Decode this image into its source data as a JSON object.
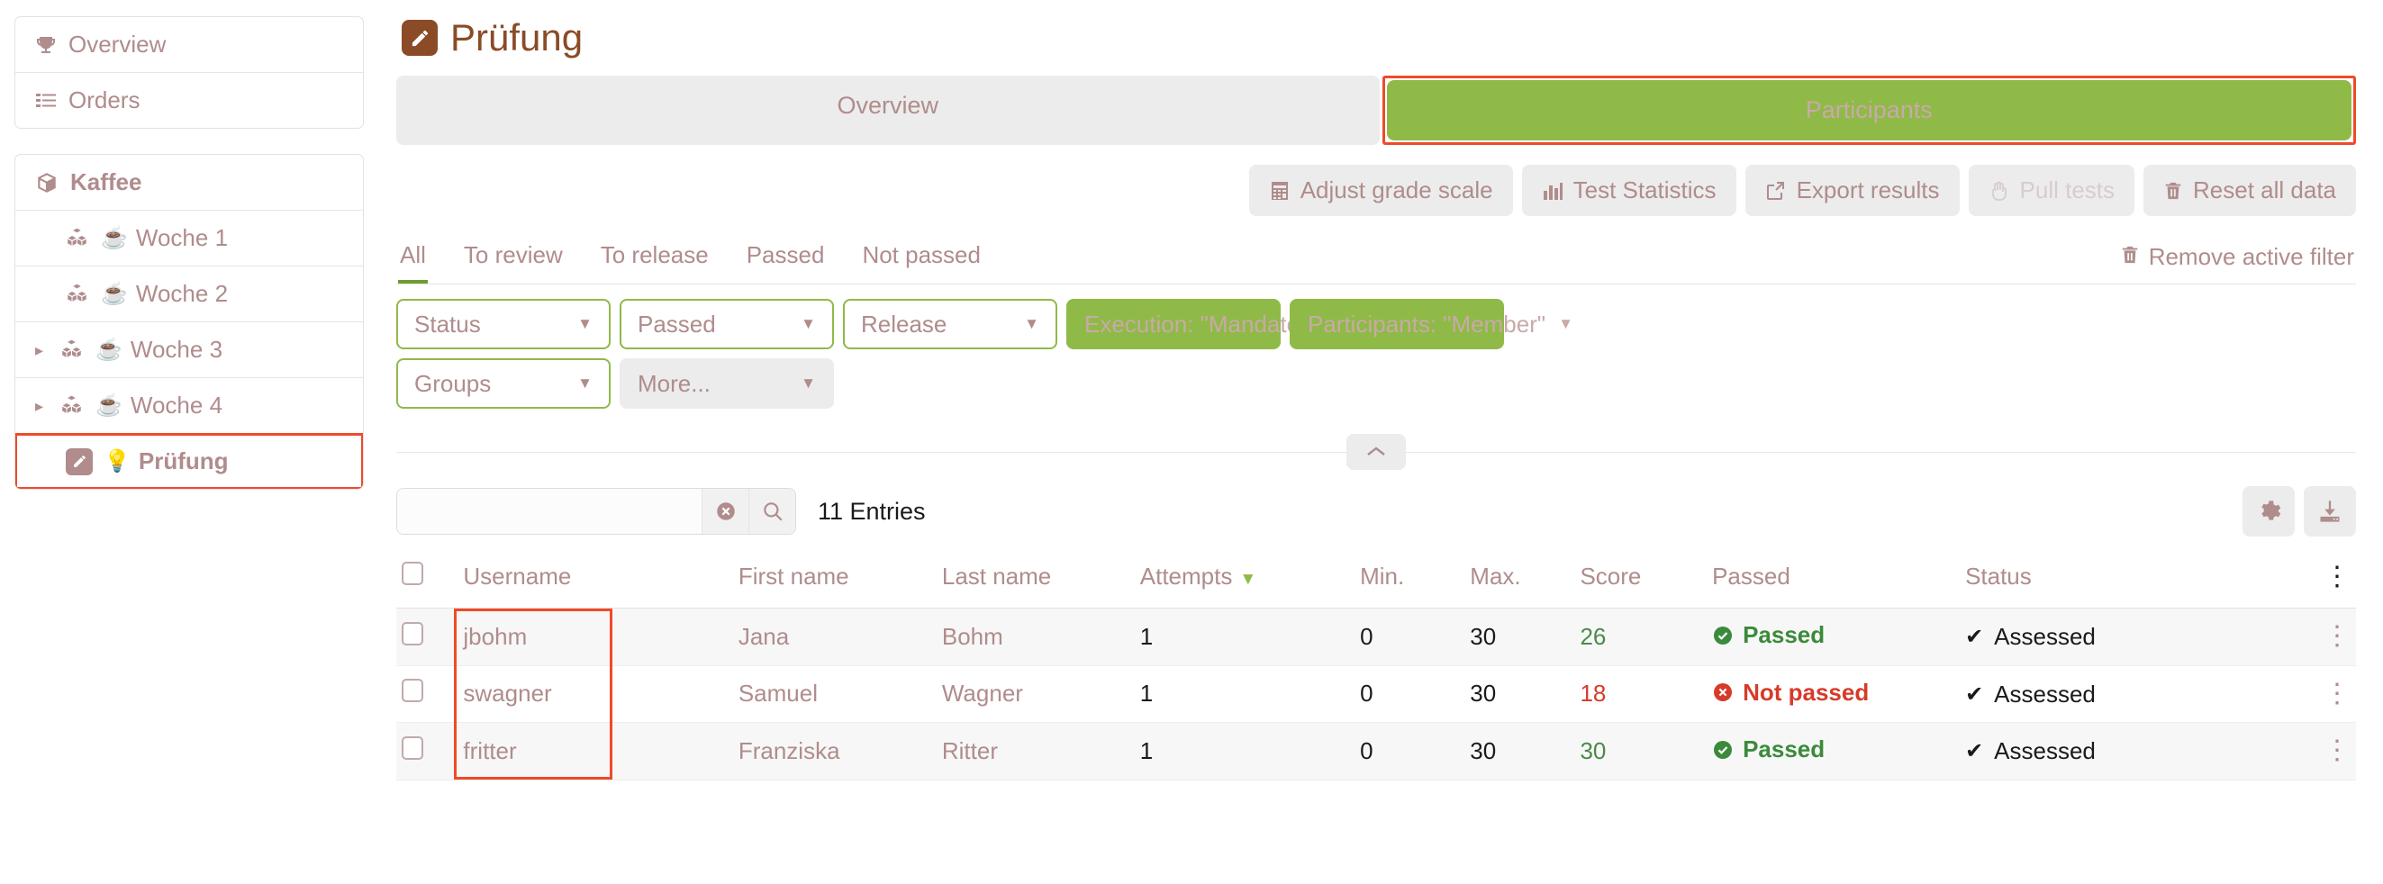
{
  "sidebar": {
    "top_items": [
      {
        "label": "Overview",
        "icon": "trophy-icon"
      },
      {
        "label": "Orders",
        "icon": "list-icon"
      }
    ],
    "course": {
      "label": "Kaffee",
      "icon": "package-icon"
    },
    "tree_items": [
      {
        "label": "Woche 1",
        "icon": "blocks-icon",
        "emoji": "☕",
        "expandable": false,
        "selected": false
      },
      {
        "label": "Woche 2",
        "icon": "blocks-icon",
        "emoji": "☕",
        "expandable": false,
        "selected": false
      },
      {
        "label": "Woche 3",
        "icon": "blocks-icon",
        "emoji": "☕",
        "expandable": true,
        "selected": false
      },
      {
        "label": "Woche 4",
        "icon": "blocks-icon",
        "emoji": "☕",
        "expandable": true,
        "selected": false
      },
      {
        "label": "Prüfung",
        "icon": "pencil-badge-icon",
        "emoji": "💡",
        "expandable": false,
        "selected": true
      }
    ]
  },
  "header": {
    "title": "Prüfung",
    "icon": "pencil-badge-icon"
  },
  "tabs": [
    {
      "label": "Overview",
      "active": false
    },
    {
      "label": "Participants",
      "active": true,
      "highlighted": true
    }
  ],
  "toolbar": {
    "buttons": [
      {
        "label": "Adjust grade scale",
        "icon": "grade-table-icon",
        "disabled": false
      },
      {
        "label": "Test Statistics",
        "icon": "bar-chart-icon",
        "disabled": false
      },
      {
        "label": "Export results",
        "icon": "export-icon",
        "disabled": false
      },
      {
        "label": "Pull tests",
        "icon": "hand-icon",
        "disabled": true
      },
      {
        "label": "Reset all data",
        "icon": "trash-icon",
        "disabled": false
      }
    ]
  },
  "filter_tabs": {
    "items": [
      {
        "label": "All",
        "active": true
      },
      {
        "label": "To review",
        "active": false
      },
      {
        "label": "To release",
        "active": false
      },
      {
        "label": "Passed",
        "active": false
      },
      {
        "label": "Not passed",
        "active": false
      }
    ],
    "remove_filter_label": "Remove active filter",
    "remove_filter_icon": "trash-icon"
  },
  "filters": {
    "row1": [
      {
        "label": "Status",
        "style": "outline"
      },
      {
        "label": "Passed",
        "style": "outline"
      },
      {
        "label": "Release",
        "style": "outline"
      },
      {
        "label": "Execution: \"Mandatory, Opt...",
        "style": "solid"
      },
      {
        "label": "Participants: \"Member\"",
        "style": "solid"
      }
    ],
    "row2": [
      {
        "label": "Groups",
        "style": "outline"
      },
      {
        "label": "More...",
        "style": "grey"
      }
    ],
    "collapse_icon": "chevron-up-icon"
  },
  "search": {
    "value": "",
    "placeholder": "",
    "clear_icon": "clear-circle-icon",
    "search_icon": "search-icon",
    "entries_label": "11 Entries"
  },
  "table_actions": {
    "settings_icon": "gear-icon",
    "download_icon": "download-icon"
  },
  "table": {
    "columns": [
      {
        "key": "checkbox",
        "label": ""
      },
      {
        "key": "username",
        "label": "Username"
      },
      {
        "key": "first_name",
        "label": "First name"
      },
      {
        "key": "last_name",
        "label": "Last name"
      },
      {
        "key": "attempts",
        "label": "Attempts",
        "sorted": true,
        "sort_dir": "desc"
      },
      {
        "key": "min",
        "label": "Min."
      },
      {
        "key": "max",
        "label": "Max."
      },
      {
        "key": "score",
        "label": "Score"
      },
      {
        "key": "passed",
        "label": "Passed"
      },
      {
        "key": "status",
        "label": "Status"
      },
      {
        "key": "menu",
        "label": ""
      }
    ],
    "rows": [
      {
        "username": "jbohm",
        "first_name": "Jana",
        "last_name": "Bohm",
        "attempts": "1",
        "min": "0",
        "max": "30",
        "score": "26",
        "passed": "Passed",
        "passed_state": "pass",
        "status": "Assessed",
        "status_icon": "check-icon"
      },
      {
        "username": "swagner",
        "first_name": "Samuel",
        "last_name": "Wagner",
        "attempts": "1",
        "min": "0",
        "max": "30",
        "score": "18",
        "passed": "Not passed",
        "passed_state": "fail",
        "status": "Assessed",
        "status_icon": "check-icon"
      },
      {
        "username": "fritter",
        "first_name": "Franziska",
        "last_name": "Ritter",
        "attempts": "1",
        "min": "0",
        "max": "30",
        "score": "30",
        "passed": "Passed",
        "passed_state": "pass",
        "status": "Assessed",
        "status_icon": "check-icon"
      }
    ]
  },
  "colors": {
    "accent_green": "#8fba47",
    "active_underline": "#6b9e2f",
    "mauve_text": "#b08c8c",
    "title_brown": "#8a4b26",
    "highlight_red": "#ef4a2a",
    "pass_green": "#3b8a3b",
    "fail_red": "#d63b2a"
  }
}
